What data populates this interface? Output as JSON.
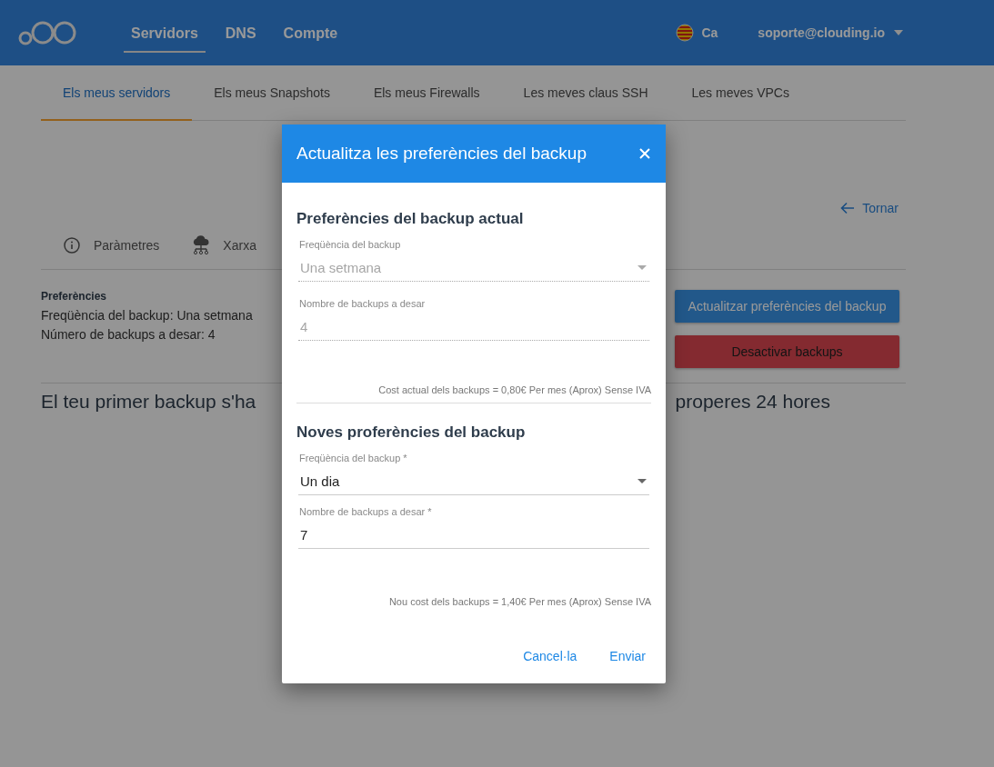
{
  "header": {
    "nav": [
      {
        "label": "Servidors",
        "selected": true
      },
      {
        "label": "DNS",
        "selected": false
      },
      {
        "label": "Compte",
        "selected": false
      }
    ],
    "language": "Ca",
    "account": "soporte@clouding.io"
  },
  "tabs": [
    {
      "label": "Els meus servidors",
      "selected": true
    },
    {
      "label": "Els meus Snapshots",
      "selected": false
    },
    {
      "label": "Els meus Firewalls",
      "selected": false
    },
    {
      "label": "Les meves claus SSH",
      "selected": false
    },
    {
      "label": "Les meves VPCs",
      "selected": false
    }
  ],
  "back_link": "Tornar",
  "server_tabs": [
    {
      "label": "Paràmetres",
      "kind": "info"
    },
    {
      "label": "Xarxa",
      "kind": "network"
    }
  ],
  "preferences": {
    "title": "Preferències",
    "lines": [
      "Freqüència del backup: Una setmana",
      "Número de backups a desar: 4"
    ]
  },
  "actions": [
    {
      "label": "Actualitzar preferències del backup",
      "kind": "primary"
    },
    {
      "label": "Desactivar backups",
      "kind": "danger"
    }
  ],
  "notice": [
    "El teu primer backup s'ha",
    "properes 24 hores"
  ],
  "dialog": {
    "title": "Actualitza les preferències del backup",
    "sections": [
      {
        "title": "Preferències del backup actual",
        "fields": [
          {
            "label": "Freqüència del backup",
            "value": "Una setmana",
            "kind": "select",
            "disabled": true
          },
          {
            "label": "Nombre de backups a desar",
            "value": "4",
            "kind": "input",
            "disabled": true
          }
        ],
        "cost": "Cost actual dels backups = 0,80€ Per mes (Aprox) Sense IVA"
      },
      {
        "title": "Noves proferències del backup",
        "fields": [
          {
            "label": "Freqüència del backup *",
            "value": "Un dia",
            "kind": "select",
            "disabled": false
          },
          {
            "label": "Nombre de backups a desar *",
            "value": "7",
            "kind": "input",
            "disabled": false
          }
        ],
        "cost": "Nou cost dels backups = 1,40€ Per mes (Aprox) Sense IVA"
      }
    ],
    "buttons": [
      "Cancel·la",
      "Enviar"
    ]
  }
}
